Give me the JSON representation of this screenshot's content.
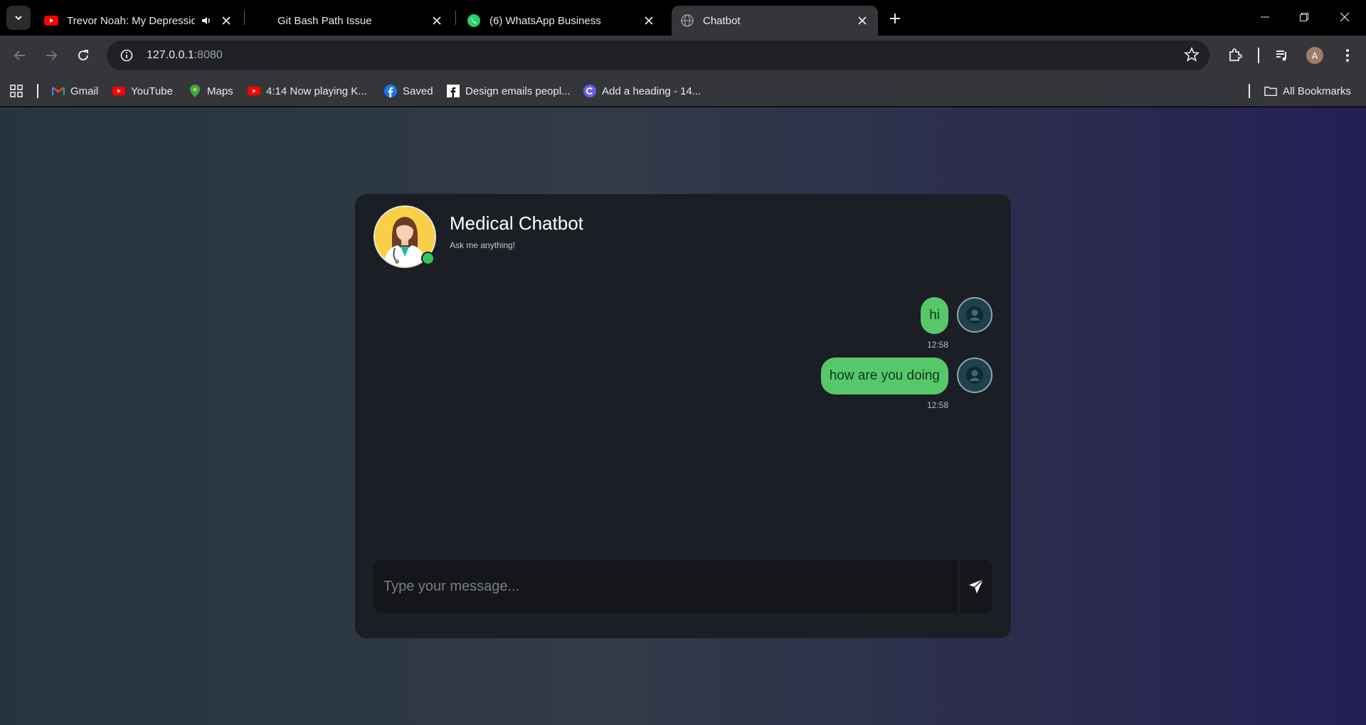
{
  "browser": {
    "tabs": [
      {
        "title": "Trevor Noah: My Depression",
        "favicon": "youtube-icon",
        "audio": true,
        "active": false
      },
      {
        "title": "Git Bash Path Issue",
        "favicon": "none",
        "active": false
      },
      {
        "title": "(6) WhatsApp Business",
        "favicon": "whatsapp-icon",
        "active": false
      },
      {
        "title": "Chatbot",
        "favicon": "globe-icon",
        "active": true
      }
    ],
    "url": {
      "host": "127.0.0.1",
      "port": ":8080"
    },
    "profile_initial": "A",
    "bookmarks": [
      {
        "label": "Gmail",
        "icon": "gmail-icon"
      },
      {
        "label": "YouTube",
        "icon": "youtube-icon"
      },
      {
        "label": "Maps",
        "icon": "maps-icon"
      },
      {
        "label": "4:14 Now playing K...",
        "icon": "youtube-icon"
      },
      {
        "label": "Saved",
        "icon": "facebook-icon"
      },
      {
        "label": "Design emails peopl...",
        "icon": "facebook-f-icon"
      },
      {
        "label": "Add a heading - 14...",
        "icon": "canva-icon"
      }
    ],
    "all_bookmarks": "All Bookmarks"
  },
  "chat": {
    "title": "Medical Chatbot",
    "subtitle": "Ask me anything!",
    "messages": [
      {
        "text": "hi",
        "time": "12:58",
        "sender": "user"
      },
      {
        "text": "how are you doing",
        "time": "12:58",
        "sender": "user"
      }
    ],
    "input_placeholder": "Type your message...",
    "colors": {
      "bubble": "#56c86a",
      "online": "#34c759",
      "card": "#1c1e26"
    }
  }
}
